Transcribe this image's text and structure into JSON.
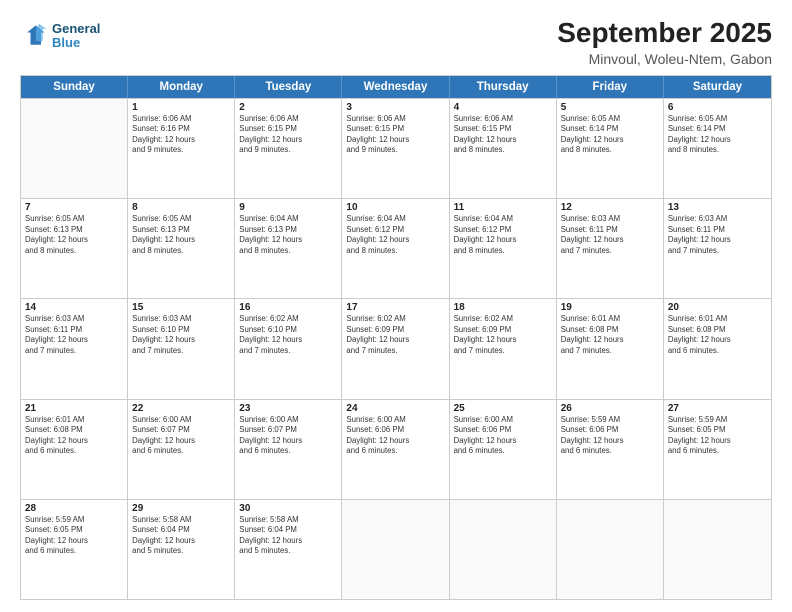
{
  "header": {
    "logo_line1": "General",
    "logo_line2": "Blue",
    "title": "September 2025",
    "subtitle": "Minvoul, Woleu-Ntem, Gabon"
  },
  "calendar": {
    "days": [
      "Sunday",
      "Monday",
      "Tuesday",
      "Wednesday",
      "Thursday",
      "Friday",
      "Saturday"
    ],
    "rows": [
      [
        {
          "day": "",
          "info": ""
        },
        {
          "day": "1",
          "info": "Sunrise: 6:06 AM\nSunset: 6:16 PM\nDaylight: 12 hours\nand 9 minutes."
        },
        {
          "day": "2",
          "info": "Sunrise: 6:06 AM\nSunset: 6:15 PM\nDaylight: 12 hours\nand 9 minutes."
        },
        {
          "day": "3",
          "info": "Sunrise: 6:06 AM\nSunset: 6:15 PM\nDaylight: 12 hours\nand 9 minutes."
        },
        {
          "day": "4",
          "info": "Sunrise: 6:06 AM\nSunset: 6:15 PM\nDaylight: 12 hours\nand 8 minutes."
        },
        {
          "day": "5",
          "info": "Sunrise: 6:05 AM\nSunset: 6:14 PM\nDaylight: 12 hours\nand 8 minutes."
        },
        {
          "day": "6",
          "info": "Sunrise: 6:05 AM\nSunset: 6:14 PM\nDaylight: 12 hours\nand 8 minutes."
        }
      ],
      [
        {
          "day": "7",
          "info": "Sunrise: 6:05 AM\nSunset: 6:13 PM\nDaylight: 12 hours\nand 8 minutes."
        },
        {
          "day": "8",
          "info": "Sunrise: 6:05 AM\nSunset: 6:13 PM\nDaylight: 12 hours\nand 8 minutes."
        },
        {
          "day": "9",
          "info": "Sunrise: 6:04 AM\nSunset: 6:13 PM\nDaylight: 12 hours\nand 8 minutes."
        },
        {
          "day": "10",
          "info": "Sunrise: 6:04 AM\nSunset: 6:12 PM\nDaylight: 12 hours\nand 8 minutes."
        },
        {
          "day": "11",
          "info": "Sunrise: 6:04 AM\nSunset: 6:12 PM\nDaylight: 12 hours\nand 8 minutes."
        },
        {
          "day": "12",
          "info": "Sunrise: 6:03 AM\nSunset: 6:11 PM\nDaylight: 12 hours\nand 7 minutes."
        },
        {
          "day": "13",
          "info": "Sunrise: 6:03 AM\nSunset: 6:11 PM\nDaylight: 12 hours\nand 7 minutes."
        }
      ],
      [
        {
          "day": "14",
          "info": "Sunrise: 6:03 AM\nSunset: 6:11 PM\nDaylight: 12 hours\nand 7 minutes."
        },
        {
          "day": "15",
          "info": "Sunrise: 6:03 AM\nSunset: 6:10 PM\nDaylight: 12 hours\nand 7 minutes."
        },
        {
          "day": "16",
          "info": "Sunrise: 6:02 AM\nSunset: 6:10 PM\nDaylight: 12 hours\nand 7 minutes."
        },
        {
          "day": "17",
          "info": "Sunrise: 6:02 AM\nSunset: 6:09 PM\nDaylight: 12 hours\nand 7 minutes."
        },
        {
          "day": "18",
          "info": "Sunrise: 6:02 AM\nSunset: 6:09 PM\nDaylight: 12 hours\nand 7 minutes."
        },
        {
          "day": "19",
          "info": "Sunrise: 6:01 AM\nSunset: 6:08 PM\nDaylight: 12 hours\nand 7 minutes."
        },
        {
          "day": "20",
          "info": "Sunrise: 6:01 AM\nSunset: 6:08 PM\nDaylight: 12 hours\nand 6 minutes."
        }
      ],
      [
        {
          "day": "21",
          "info": "Sunrise: 6:01 AM\nSunset: 6:08 PM\nDaylight: 12 hours\nand 6 minutes."
        },
        {
          "day": "22",
          "info": "Sunrise: 6:00 AM\nSunset: 6:07 PM\nDaylight: 12 hours\nand 6 minutes."
        },
        {
          "day": "23",
          "info": "Sunrise: 6:00 AM\nSunset: 6:07 PM\nDaylight: 12 hours\nand 6 minutes."
        },
        {
          "day": "24",
          "info": "Sunrise: 6:00 AM\nSunset: 6:06 PM\nDaylight: 12 hours\nand 6 minutes."
        },
        {
          "day": "25",
          "info": "Sunrise: 6:00 AM\nSunset: 6:06 PM\nDaylight: 12 hours\nand 6 minutes."
        },
        {
          "day": "26",
          "info": "Sunrise: 5:59 AM\nSunset: 6:06 PM\nDaylight: 12 hours\nand 6 minutes."
        },
        {
          "day": "27",
          "info": "Sunrise: 5:59 AM\nSunset: 6:05 PM\nDaylight: 12 hours\nand 6 minutes."
        }
      ],
      [
        {
          "day": "28",
          "info": "Sunrise: 5:59 AM\nSunset: 6:05 PM\nDaylight: 12 hours\nand 6 minutes."
        },
        {
          "day": "29",
          "info": "Sunrise: 5:58 AM\nSunset: 6:04 PM\nDaylight: 12 hours\nand 5 minutes."
        },
        {
          "day": "30",
          "info": "Sunrise: 5:58 AM\nSunset: 6:04 PM\nDaylight: 12 hours\nand 5 minutes."
        },
        {
          "day": "",
          "info": ""
        },
        {
          "day": "",
          "info": ""
        },
        {
          "day": "",
          "info": ""
        },
        {
          "day": "",
          "info": ""
        }
      ]
    ]
  }
}
